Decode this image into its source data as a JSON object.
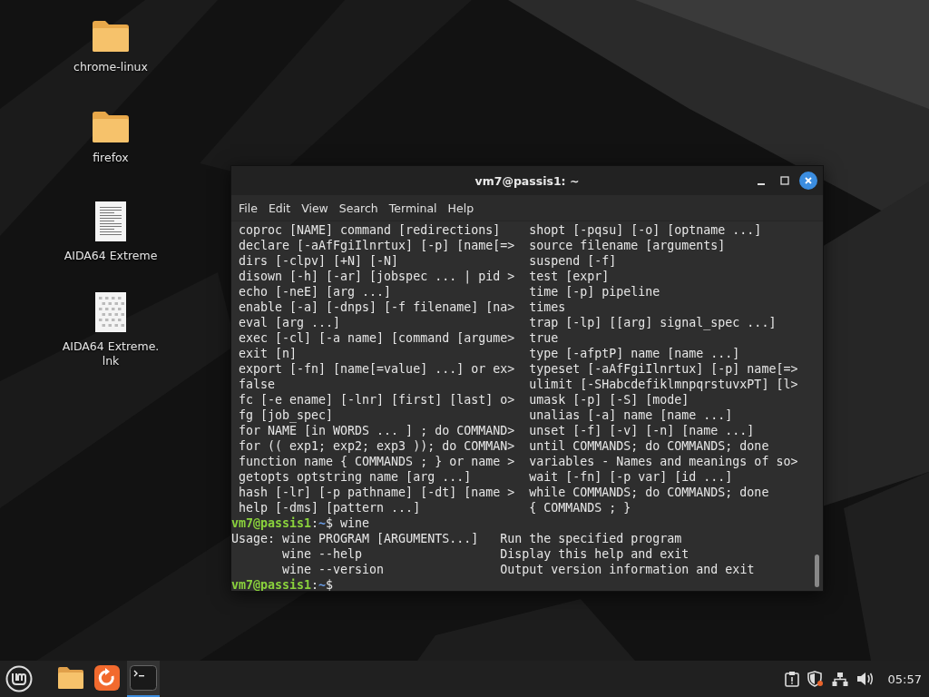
{
  "desktop_icons": [
    {
      "kind": "folder",
      "label": "chrome-linux"
    },
    {
      "kind": "folder",
      "label": "firefox"
    },
    {
      "kind": "document",
      "label": "AIDA64 Extreme"
    },
    {
      "kind": "link",
      "label": "AIDA64 Extreme.\nlnk"
    }
  ],
  "terminal": {
    "title": "vm7@passis1: ~",
    "menu": [
      "File",
      "Edit",
      "View",
      "Search",
      "Terminal",
      "Help"
    ],
    "help_rows": [
      {
        "left": "coproc [NAME] command [redirections]",
        "right": "shopt [-pqsu] [-o] [optname ...]"
      },
      {
        "left": "declare [-aAfFgiIlnrtux] [-p] [name[=>",
        "right": "source filename [arguments]"
      },
      {
        "left": "dirs [-clpv] [+N] [-N]",
        "right": "suspend [-f]"
      },
      {
        "left": "disown [-h] [-ar] [jobspec ... | pid >",
        "right": "test [expr]"
      },
      {
        "left": "echo [-neE] [arg ...]",
        "right": "time [-p] pipeline"
      },
      {
        "left": "enable [-a] [-dnps] [-f filename] [na>",
        "right": "times"
      },
      {
        "left": "eval [arg ...]",
        "right": "trap [-lp] [[arg] signal_spec ...]"
      },
      {
        "left": "exec [-cl] [-a name] [command [argume>",
        "right": "true"
      },
      {
        "left": "exit [n]",
        "right": "type [-afptP] name [name ...]"
      },
      {
        "left": "export [-fn] [name[=value] ...] or ex>",
        "right": "typeset [-aAfFgiIlnrtux] [-p] name[=>"
      },
      {
        "left": "false",
        "right": "ulimit [-SHabcdefiklmnpqrstuvxPT] [l>"
      },
      {
        "left": "fc [-e ename] [-lnr] [first] [last] o>",
        "right": "umask [-p] [-S] [mode]"
      },
      {
        "left": "fg [job_spec]",
        "right": "unalias [-a] name [name ...]"
      },
      {
        "left": "for NAME [in WORDS ... ] ; do COMMAND>",
        "right": "unset [-f] [-v] [-n] [name ...]"
      },
      {
        "left": "for (( exp1; exp2; exp3 )); do COMMAN>",
        "right": "until COMMANDS; do COMMANDS; done"
      },
      {
        "left": "function name { COMMANDS ; } or name >",
        "right": "variables - Names and meanings of so>"
      },
      {
        "left": "getopts optstring name [arg ...]",
        "right": "wait [-fn] [-p var] [id ...]"
      },
      {
        "left": "hash [-lr] [-p pathname] [-dt] [name >",
        "right": "while COMMANDS; do COMMANDS; done"
      },
      {
        "left": "help [-dms] [pattern ...]",
        "right": "{ COMMANDS ; }"
      }
    ],
    "session": [
      {
        "kind": "prompt",
        "user": "vm7@passis1",
        "separator": ":",
        "path": "~",
        "symbol": "$",
        "command": " wine"
      },
      {
        "kind": "output",
        "text": "Usage: wine PROGRAM [ARGUMENTS...]   Run the specified program"
      },
      {
        "kind": "output",
        "text": "       wine --help                   Display this help and exit"
      },
      {
        "kind": "output",
        "text": "       wine --version                Output version information and exit"
      },
      {
        "kind": "prompt",
        "user": "vm7@passis1",
        "separator": ":",
        "path": "~",
        "symbol": "$"
      }
    ]
  },
  "taskbar": {
    "apps": [
      {
        "kind": "files",
        "selected": false
      },
      {
        "kind": "updater",
        "selected": false
      },
      {
        "kind": "terminal",
        "selected": true
      }
    ],
    "clock": "05:57"
  }
}
